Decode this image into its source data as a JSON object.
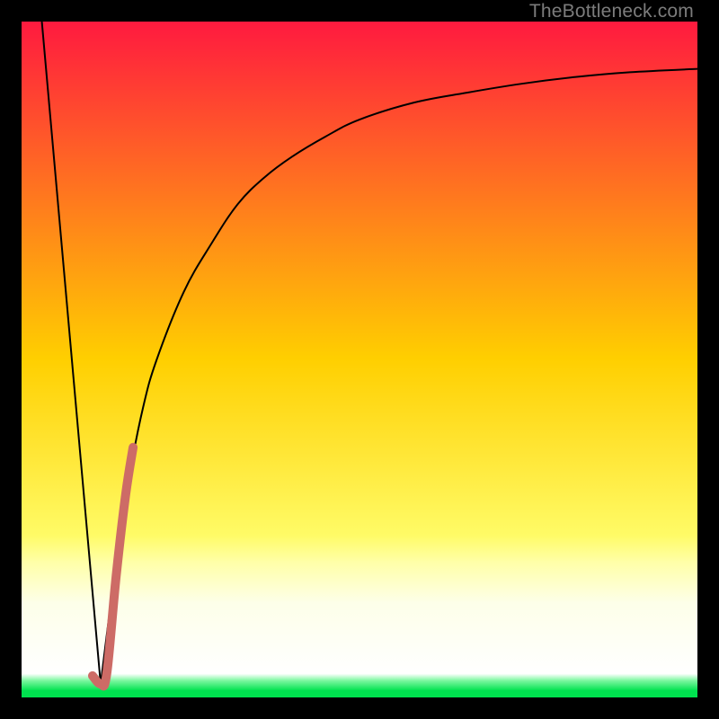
{
  "watermark": {
    "text": "TheBottleneck.com"
  },
  "chart_data": {
    "type": "line",
    "title": "",
    "xlabel": "",
    "ylabel": "",
    "xlim": [
      0,
      100
    ],
    "ylim": [
      0,
      100
    ],
    "grid": false,
    "legend": false,
    "background_gradient": {
      "stops": [
        {
          "offset": 0.0,
          "color": "#ff1a3f"
        },
        {
          "offset": 0.5,
          "color": "#ffcf00"
        },
        {
          "offset": 0.76,
          "color": "#fffb66"
        },
        {
          "offset": 0.8,
          "color": "#ffffa8"
        },
        {
          "offset": 0.86,
          "color": "#fdffe9"
        },
        {
          "offset": 0.965,
          "color": "#ffffff"
        },
        {
          "offset": 0.975,
          "color": "#7cf7a0"
        },
        {
          "offset": 0.99,
          "color": "#00e24f"
        },
        {
          "offset": 1.0,
          "color": "#00e24f"
        }
      ]
    },
    "series": [
      {
        "name": "left-descent",
        "x": [
          3,
          11.7
        ],
        "y": [
          100,
          2
        ],
        "stroke": "#000000",
        "width": 2
      },
      {
        "name": "curve",
        "x": [
          11.7,
          14,
          16,
          18,
          20,
          24,
          28,
          32,
          36,
          40,
          45,
          50,
          58,
          66,
          74,
          82,
          90,
          100
        ],
        "y": [
          2,
          20,
          33,
          43,
          50,
          60,
          67,
          73,
          77,
          80,
          83,
          85.5,
          88,
          89.5,
          90.8,
          91.8,
          92.5,
          93
        ],
        "stroke": "#000000",
        "width": 2
      },
      {
        "name": "highlight-segment",
        "x": [
          10.5,
          11.7,
          12.6,
          14,
          15.4,
          16.5
        ],
        "y": [
          3.2,
          2,
          3.5,
          18,
          30,
          37
        ],
        "stroke": "#cd6b66",
        "width": 10,
        "linecap": "round"
      }
    ]
  }
}
